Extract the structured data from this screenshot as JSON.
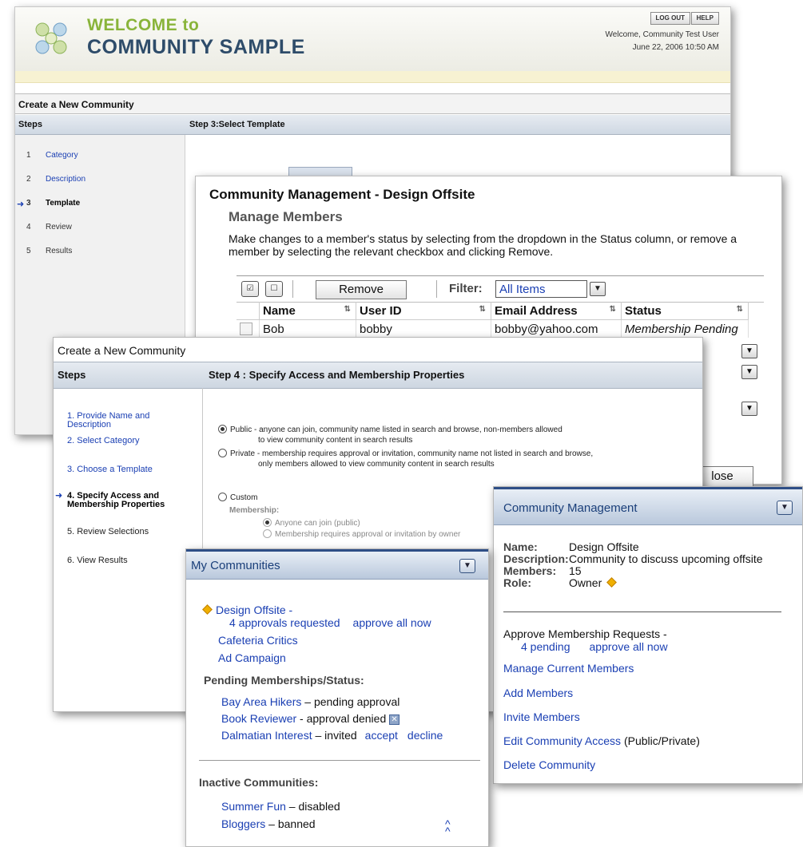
{
  "main_page": {
    "welcome_line": "WELCOME to",
    "title": "COMMUNITY SAMPLE",
    "logout_label": "LOG OUT",
    "help_label": "HELP",
    "welcome_user": "Welcome, Community Test User",
    "date": "June 22, 2006 10:50 AM",
    "section_title": "Create a New Community",
    "steps_header": "Steps",
    "step_header": "Step 3:Select Template",
    "steps": [
      {
        "num": "1",
        "label": "Category"
      },
      {
        "num": "2",
        "label": "Description"
      },
      {
        "num": "3",
        "label": "Template"
      },
      {
        "num": "4",
        "label": "Review"
      },
      {
        "num": "5",
        "label": "Results"
      }
    ]
  },
  "manage_members": {
    "title": "Community Management - Design Offsite",
    "subtitle": "Manage Members",
    "description": "Make changes to a member's status by selecting from the dropdown in the Status column, or remove a member by selecting the relevant checkbox and clicking Remove.",
    "remove_label": "Remove",
    "filter_label": "Filter:",
    "filter_value": "All Items",
    "columns": [
      "Name",
      "User ID",
      "Email Address",
      "Status"
    ],
    "rows": [
      {
        "name": "Bob",
        "user_id": "bobby",
        "email": "bobby@yahoo.com",
        "status": "Membership Pending"
      }
    ],
    "close_label": "lose"
  },
  "create_community": {
    "title": "Create a New Community",
    "steps_header": "Steps",
    "step_header": "Step 4 : Specify Access and Membership Properties",
    "steps": [
      "1. Provide Name and Description",
      "2. Select Category",
      "3. Choose a Template",
      "4. Specify Access and Membership Properties",
      "5. Review Selections",
      "6. View Results"
    ],
    "public_line1": "Public - anyone can join, community name listed in search and browse, non-members allowed",
    "public_line2": "to view community content in search results",
    "private_line1": "Private - membership requires approval or invitation, community name not listed in search and browse,",
    "private_line2": "only members allowed to view community content in search results",
    "custom_label": "Custom",
    "membership_label": "Membership:",
    "membership_opt1": "Anyone can join (public)",
    "membership_opt2": "Membership requires approval or invitation by owner"
  },
  "my_communities": {
    "title": "My Communities",
    "featured": "Design Offsite -",
    "approvals": "4 approvals requested",
    "approve_all": "approve all now",
    "others": [
      "Cafeteria Critics",
      "Ad Campaign"
    ],
    "pending_header": "Pending Memberships/Status:",
    "pending": [
      {
        "name": "Bay Area Hikers",
        "status": " – pending approval"
      },
      {
        "name": "Book Reviewer",
        "status": " - approval denied"
      },
      {
        "name": "Dalmatian Interest",
        "status": " – invited"
      }
    ],
    "accept_label": "accept",
    "decline_label": "decline",
    "inactive_header": "Inactive Communities:",
    "inactive": [
      {
        "name": "Summer Fun",
        "status": " – disabled"
      },
      {
        "name": "Bloggers",
        "status": " – banned"
      }
    ]
  },
  "community_management": {
    "title": "Community Management",
    "name_key": "Name:",
    "name_val": "Design Offsite",
    "desc_key": "Description:",
    "desc_val": "Community to discuss upcoming offsite",
    "members_key": "Members:",
    "members_val": "15",
    "role_key": "Role:",
    "role_val": "Owner",
    "approve_header": "Approve Membership Requests -",
    "pending_link": "4 pending",
    "approve_all": "approve all now",
    "manage_link": "Manage Current Members",
    "add_link": "Add Members",
    "invite_link": "Invite  Members",
    "edit_link": "Edit Community Access",
    "edit_suffix": " (Public/Private)",
    "delete_link": "Delete Community"
  },
  "colors": {
    "link": "#1a3fb3",
    "welcome_green": "#89b43a",
    "title_navy": "#2e4c6a",
    "header_blue": "#2e4e86"
  }
}
